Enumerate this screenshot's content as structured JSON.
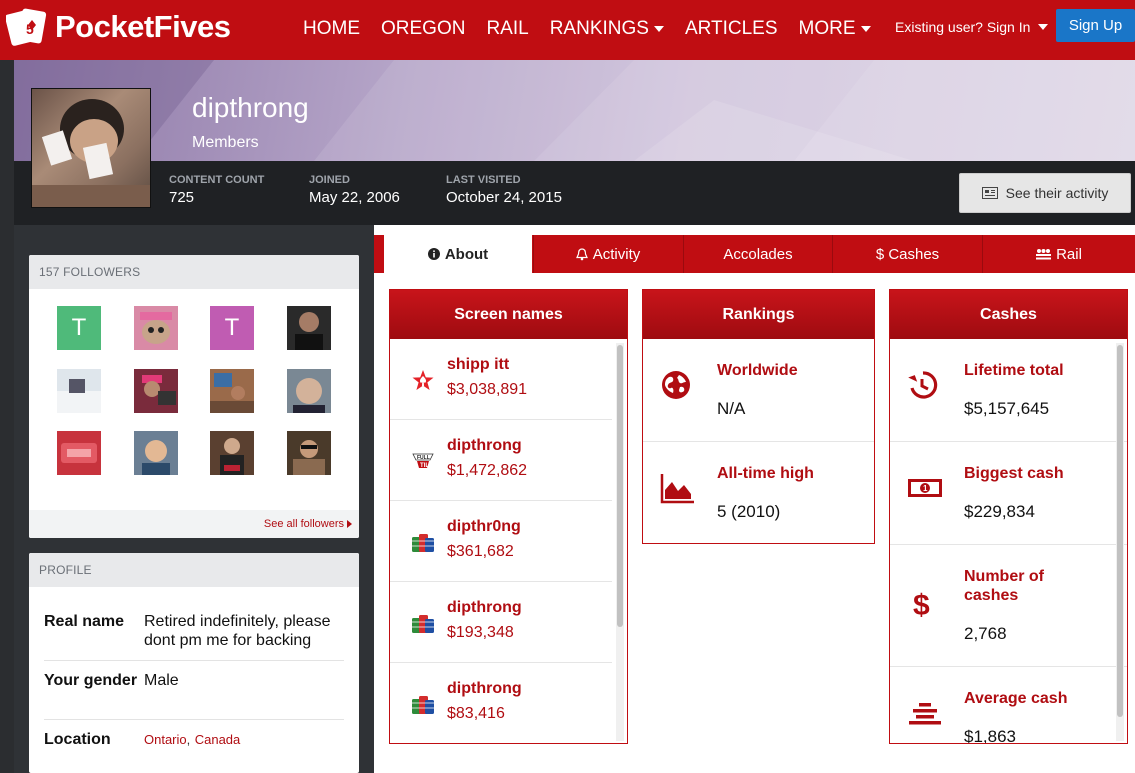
{
  "nav": {
    "brand": "PocketFives",
    "items": [
      {
        "label": "HOME",
        "caret": false
      },
      {
        "label": "OREGON",
        "caret": false
      },
      {
        "label": "RAIL",
        "caret": false
      },
      {
        "label": "RANKINGS",
        "caret": true
      },
      {
        "label": "ARTICLES",
        "caret": false
      },
      {
        "label": "MORE",
        "caret": true
      }
    ],
    "signin": "Existing user? Sign In",
    "signup": "Sign Up"
  },
  "profile_header": {
    "username": "dipthrong",
    "group": "Members",
    "stats": [
      {
        "label": "CONTENT COUNT",
        "value": "725"
      },
      {
        "label": "JOINED",
        "value": "May 22, 2006"
      },
      {
        "label": "LAST VISITED",
        "value": "October 24, 2015"
      }
    ],
    "activity_button": "See their activity"
  },
  "followers": {
    "title": "157 FOLLOWERS",
    "see_all": "See all followers",
    "avatars": [
      {
        "letter": "T",
        "color": "#4fba7a"
      },
      {
        "letter": "",
        "color": "#d98aa6"
      },
      {
        "letter": "T",
        "color": "#c05cb2"
      },
      {
        "letter": "",
        "color": "#2a2a2a"
      },
      {
        "letter": "",
        "color": "#9aa4ae"
      },
      {
        "letter": "",
        "color": "#7a2b3c"
      },
      {
        "letter": "",
        "color": "#9a6a4a"
      },
      {
        "letter": "",
        "color": "#7a8894"
      },
      {
        "letter": "",
        "color": "#c7333d"
      },
      {
        "letter": "",
        "color": "#6b7f94"
      },
      {
        "letter": "",
        "color": "#5a4030"
      },
      {
        "letter": "",
        "color": "#4a3a2a"
      }
    ]
  },
  "profile": {
    "title": "PROFILE",
    "real_name_key": "Real name",
    "real_name_val": "Retired indefinitely, please dont pm me for backing",
    "gender_key": "Your gender",
    "gender_val": "Male",
    "location_key": "Location",
    "location_city": "Ontario",
    "location_sep": ",",
    "location_country": "Canada"
  },
  "tabs": [
    {
      "label": "About",
      "icon": "info-icon"
    },
    {
      "label": "Activity",
      "icon": "bell-icon"
    },
    {
      "label": "Accolades",
      "icon": ""
    },
    {
      "label": "$ Cashes",
      "icon": ""
    },
    {
      "label": "Rail",
      "icon": "crowd-icon"
    }
  ],
  "screen_names": {
    "title": "Screen names",
    "rows": [
      {
        "name": "shipp itt",
        "amount": "$3,038,891",
        "icon": "pokerstars-icon"
      },
      {
        "name": "dipthrong",
        "amount": "$1,472,862",
        "icon": "fulltilt-icon"
      },
      {
        "name": "dipthr0ng",
        "amount": "$361,682",
        "icon": "chips-icon"
      },
      {
        "name": "dipthrong",
        "amount": "$193,348",
        "icon": "chips-icon"
      },
      {
        "name": "dipthrong",
        "amount": "$83,416",
        "icon": "chips-icon"
      }
    ]
  },
  "rankings": {
    "title": "Rankings",
    "rows": [
      {
        "title": "Worldwide",
        "value": "N/A",
        "icon": "globe-icon"
      },
      {
        "title": "All-time high",
        "value": "5 (2010)",
        "icon": "area-chart-icon"
      }
    ]
  },
  "cashes": {
    "title": "Cashes",
    "rows": [
      {
        "title": "Lifetime total",
        "value": "$5,157,645",
        "icon": "history-icon"
      },
      {
        "title": "Biggest cash",
        "value": "$229,834",
        "icon": "money-icon"
      },
      {
        "title": "Number of cashes",
        "value": "2,768",
        "icon": "dollar-icon"
      },
      {
        "title": "Average cash",
        "value": "$1,863",
        "icon": "stack-icon"
      }
    ]
  },
  "colors": {
    "brand_red": "#c00d12",
    "signup_blue": "#1a76c8"
  }
}
